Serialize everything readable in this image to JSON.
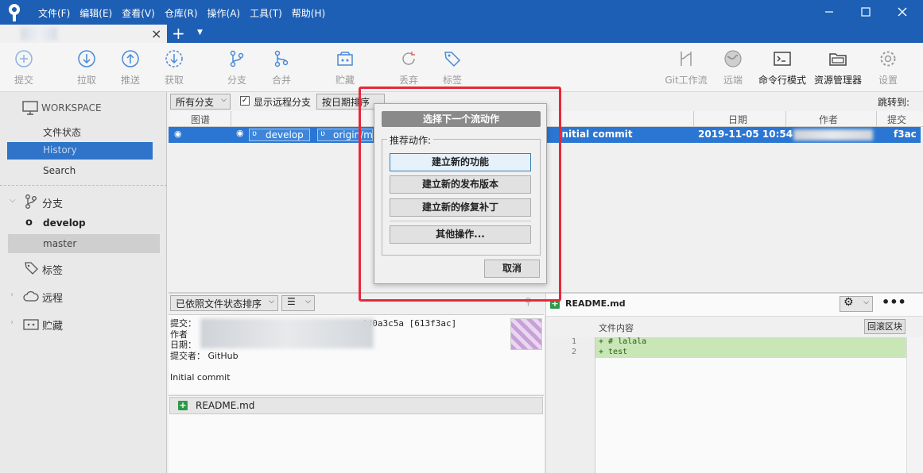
{
  "menu": [
    "文件(F)",
    "编辑(E)",
    "查看(V)",
    "仓库(R)",
    "操作(A)",
    "工具(T)",
    "帮助(H)"
  ],
  "toolbar": {
    "commit": "提交",
    "pull": "拉取",
    "push": "推送",
    "fetch": "获取",
    "branch": "分支",
    "merge": "合并",
    "stash": "贮藏",
    "discard": "丢弃",
    "tag": "标签",
    "gitflow": "Git工作流",
    "remote": "远端",
    "terminal": "命令行模式",
    "explorer": "资源管理器",
    "settings": "设置"
  },
  "sidebar": {
    "workspace": "WORKSPACE",
    "file_status": "文件状态",
    "history": "History",
    "search": "Search",
    "branches": "分支",
    "branch_develop": "develop",
    "branch_master": "master",
    "tags": "标签",
    "remotes": "远程",
    "stashes": "贮藏"
  },
  "history": {
    "branch_filter": "所有分支",
    "show_remote": "显示远程分支",
    "sort": "按日期排序",
    "jump_to": "跳转到:",
    "columns": {
      "graph": "图谱",
      "date": "日期",
      "author": "作者",
      "commit": "提交"
    },
    "row": {
      "ref_develop": "develop",
      "ref_origin": "origin/ma",
      "message": "Initial commit",
      "date": "2019-11-05 10:54",
      "commit": "f3ac"
    }
  },
  "files": {
    "sort": "已依照文件状态排序",
    "commit_label": "提交：",
    "commit_hash": "4d0a3c5a [613f3ac]",
    "author_label": "作者",
    "date_label": "日期：",
    "committer_label": "提交者：",
    "committer": "GitHub",
    "message": "Initial commit",
    "file_name": "README.md"
  },
  "diff": {
    "file_name": "README.md",
    "hunk_header": "文件内容",
    "revert_hunk": "回滚区块",
    "lines": [
      {
        "num": "1",
        "text": "+ # lalala"
      },
      {
        "num": "2",
        "text": "+ test"
      }
    ]
  },
  "dialog": {
    "title": "选择下一个流动作",
    "group_label": "推荐动作:",
    "new_feature": "建立新的功能",
    "new_release": "建立新的发布版本",
    "new_hotfix": "建立新的修复补丁",
    "other": "其他操作...",
    "cancel": "取消"
  },
  "colors": {
    "titlebar": "#1d5fb4",
    "selection": "#2a76d2",
    "highlight": "#e8283a",
    "added": "#2e9a49"
  }
}
